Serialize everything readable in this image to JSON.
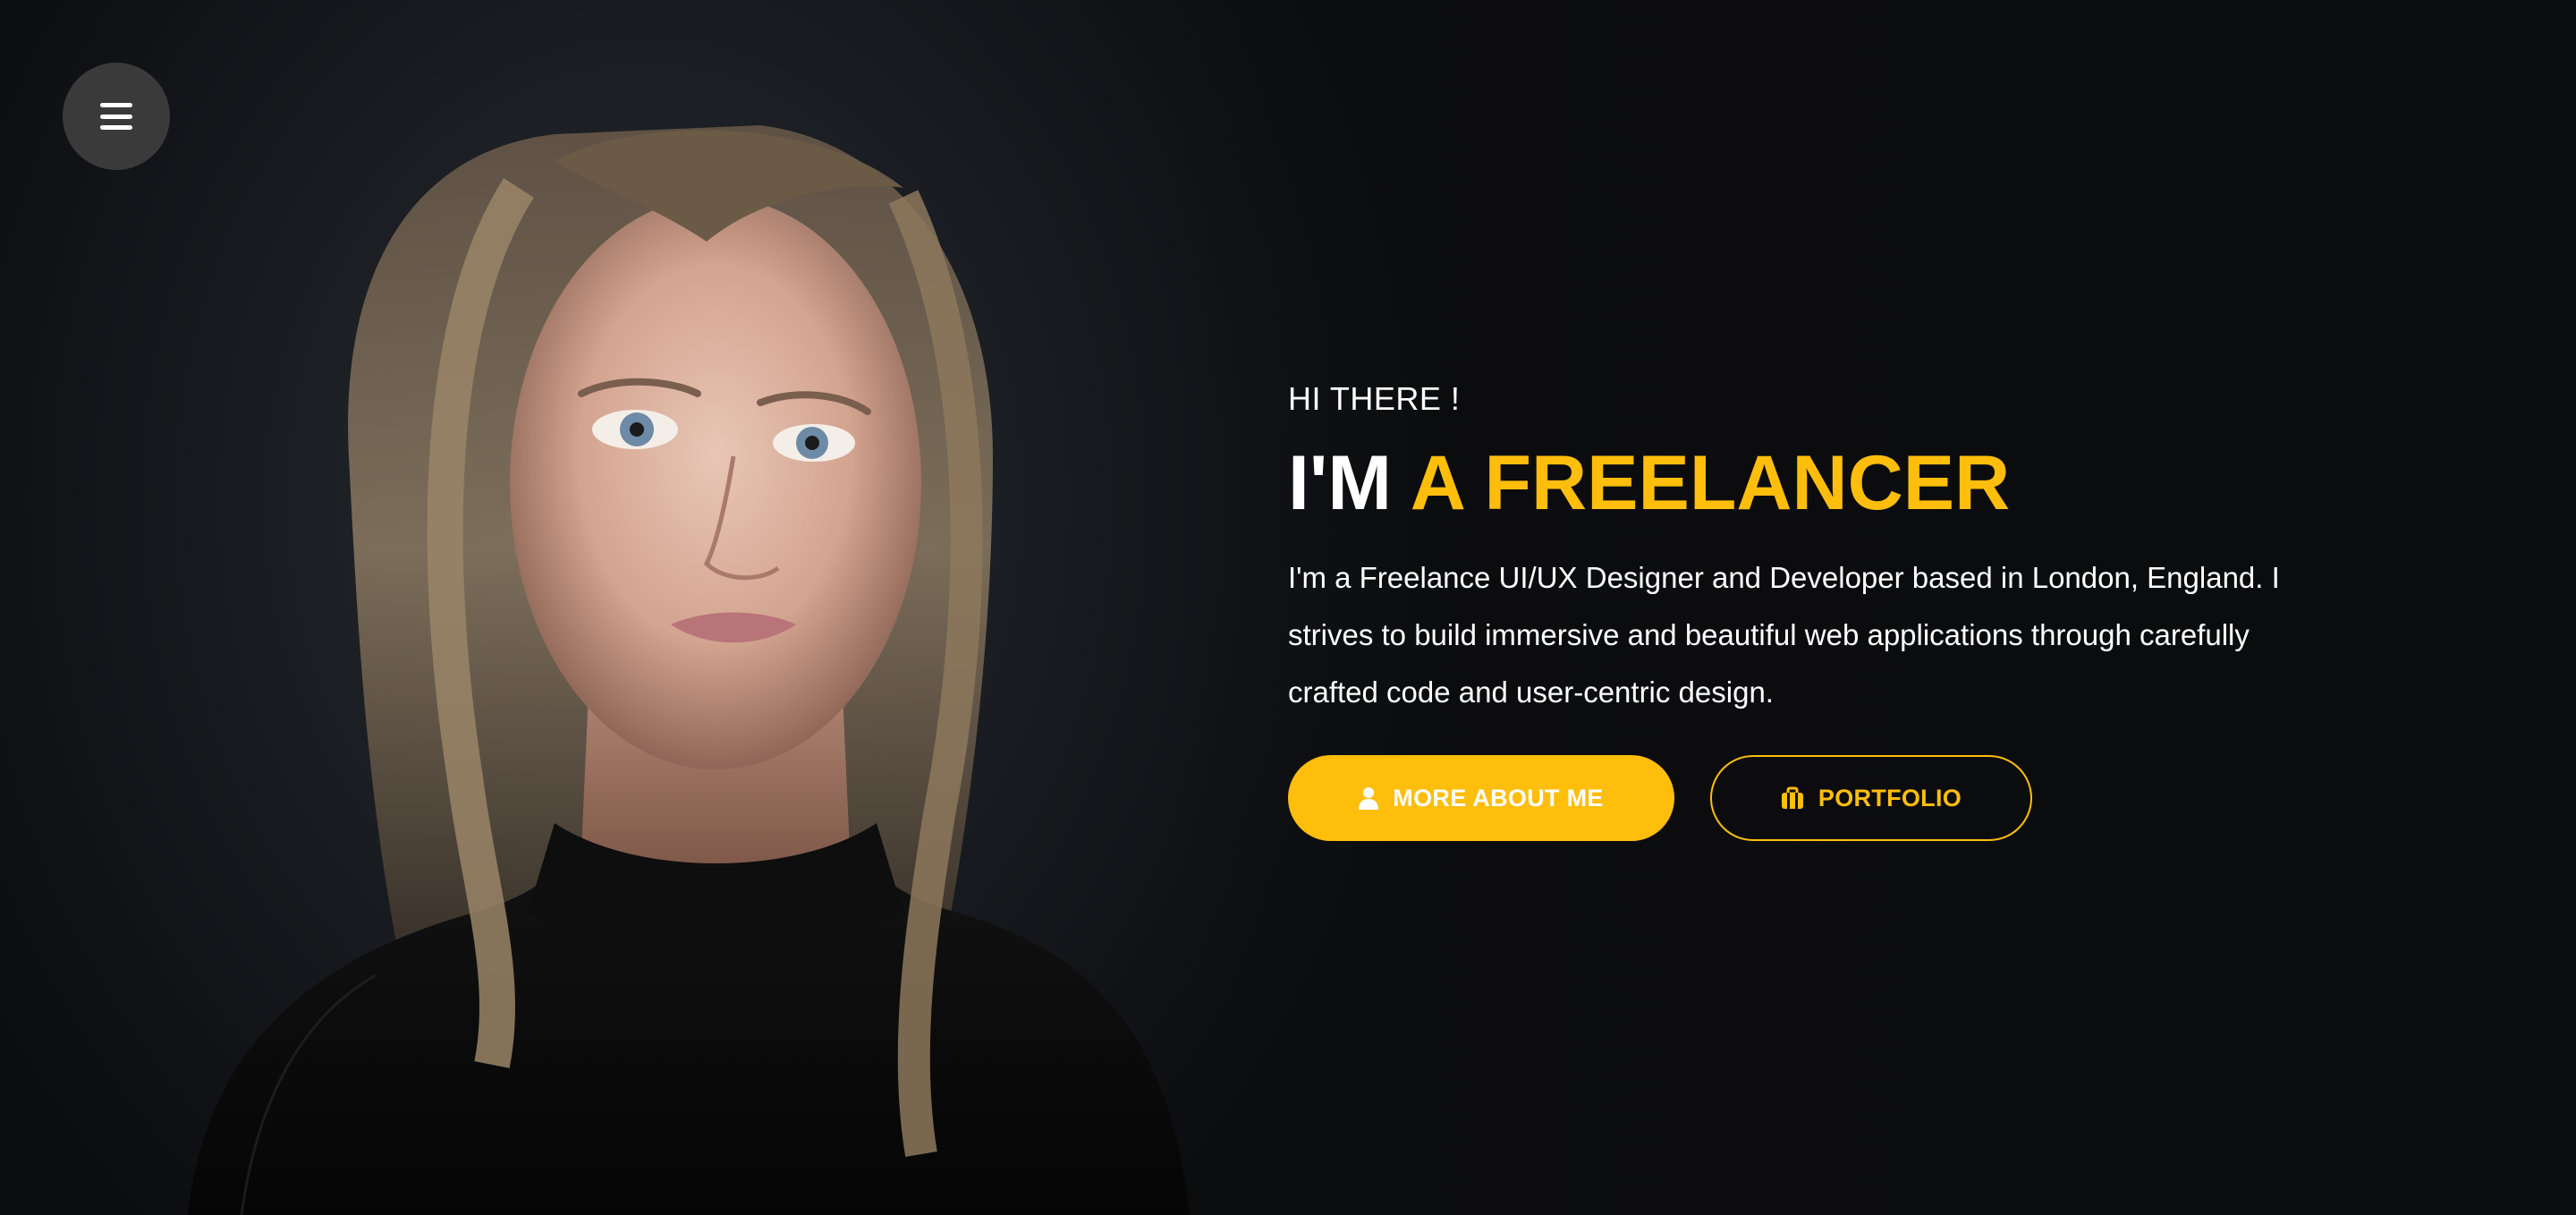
{
  "menu": {
    "icon": "hamburger-menu-icon"
  },
  "hero": {
    "greeting": "HI THERE !",
    "headline_prefix": "I'M",
    "headline_accent": "A FREELANCER",
    "intro": "I'm a Freelance UI/UX Designer and Developer based in London, England. I strives to build immersive and beautiful web applications through carefully crafted code and user-centric design."
  },
  "buttons": {
    "primary": {
      "label": "MORE ABOUT ME",
      "icon": "user-icon"
    },
    "secondary": {
      "label": "PORTFOLIO",
      "icon": "briefcase-icon"
    }
  },
  "colors": {
    "accent": "#ffbe0b",
    "background": "#0d0f12",
    "text": "#ffffff",
    "menu_button": "#3a3a3a"
  }
}
